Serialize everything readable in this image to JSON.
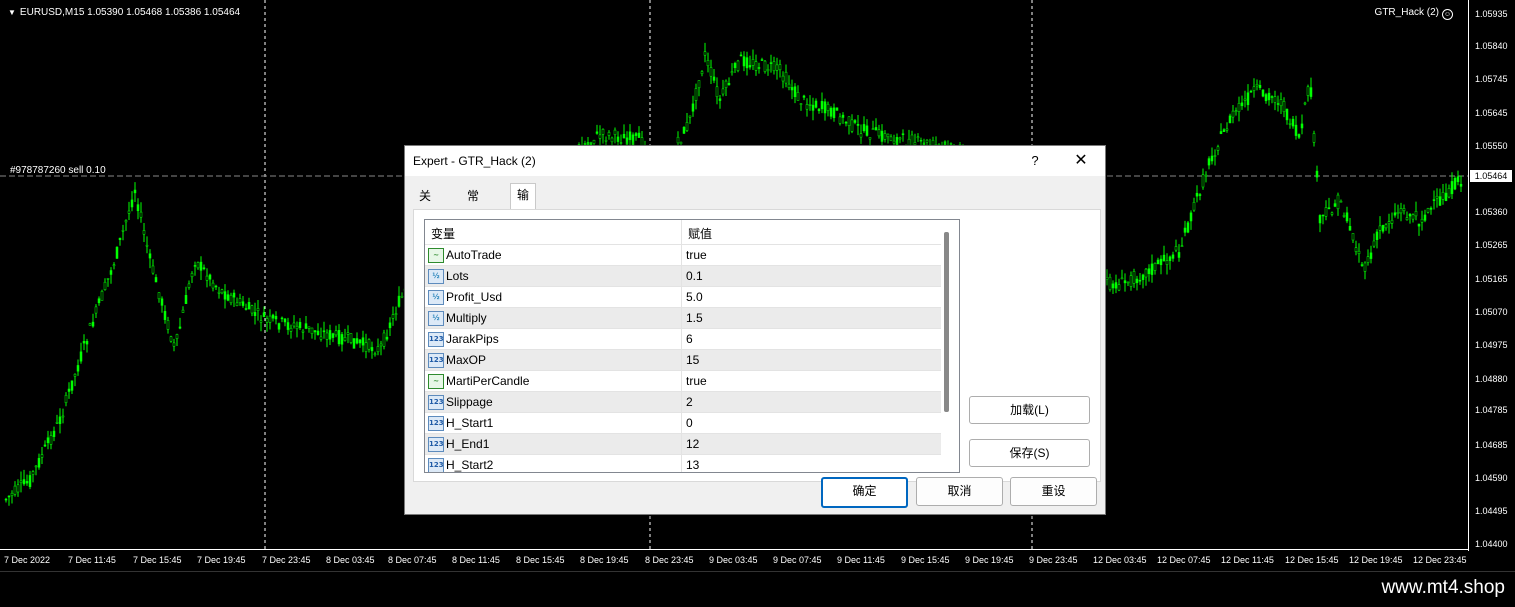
{
  "chart": {
    "symbol_title": "EURUSD,M15  1.05390 1.05468 1.05386 1.05464",
    "ea_name": "GTR_Hack (2)",
    "order_label": "#978787260 sell 0.10",
    "current_price": "1.05464",
    "price_ticks": [
      "1.05935",
      "1.05840",
      "1.05745",
      "1.05645",
      "1.05550",
      "1.05360",
      "1.05265",
      "1.05165",
      "1.05070",
      "1.04975",
      "1.04880",
      "1.04785",
      "1.04685",
      "1.04590",
      "1.04495",
      "1.04400"
    ],
    "time_ticks": [
      "7 Dec 2022",
      "7 Dec 11:45",
      "7 Dec 15:45",
      "7 Dec 19:45",
      "7 Dec 23:45",
      "8 Dec 03:45",
      "8 Dec 07:45",
      "8 Dec 11:45",
      "8 Dec 15:45",
      "8 Dec 19:45",
      "8 Dec 23:45",
      "9 Dec 03:45",
      "9 Dec 07:45",
      "9 Dec 11:45",
      "9 Dec 15:45",
      "9 Dec 19:45",
      "9 Dec 23:45",
      "12 Dec 03:45",
      "12 Dec 07:45",
      "12 Dec 11:45",
      "12 Dec 15:45",
      "12 Dec 19:45",
      "12 Dec 23:45"
    ],
    "candle_color": "#00ff00"
  },
  "dialog": {
    "title": "Expert - GTR_Hack (2)",
    "help_label": "?",
    "close_label": "✕",
    "tabs": [
      "关于",
      "常用",
      "输入参数"
    ],
    "grid": {
      "col_variable": "变量",
      "col_value": "赋值",
      "rows": [
        {
          "type": "bool",
          "icon": "~",
          "name": "AutoTrade",
          "value": "true"
        },
        {
          "type": "dbl",
          "icon": "½",
          "name": "Lots",
          "value": "0.1"
        },
        {
          "type": "dbl",
          "icon": "½",
          "name": "Profit_Usd",
          "value": "5.0"
        },
        {
          "type": "dbl",
          "icon": "½",
          "name": "Multiply",
          "value": "1.5"
        },
        {
          "type": "int",
          "icon": "123",
          "name": "JarakPips",
          "value": "6"
        },
        {
          "type": "int",
          "icon": "123",
          "name": "MaxOP",
          "value": "15"
        },
        {
          "type": "bool",
          "icon": "~",
          "name": "MartiPerCandle",
          "value": "true"
        },
        {
          "type": "int",
          "icon": "123",
          "name": "Slippage",
          "value": "2"
        },
        {
          "type": "int",
          "icon": "123",
          "name": "H_Start1",
          "value": "0"
        },
        {
          "type": "int",
          "icon": "123",
          "name": "H_End1",
          "value": "12"
        },
        {
          "type": "int",
          "icon": "123",
          "name": "H_Start2",
          "value": "13"
        }
      ]
    },
    "load_button": "加载(L)",
    "save_button": "保存(S)",
    "ok_button": "确定",
    "cancel_button": "取消",
    "reset_button": "重设"
  },
  "footer": {
    "url": "www.mt4.shop"
  }
}
